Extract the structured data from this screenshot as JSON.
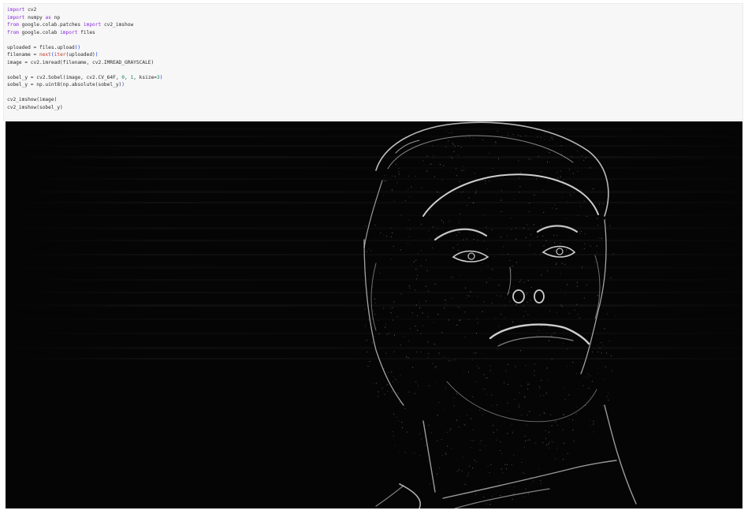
{
  "code_cell": {
    "lines": [
      [
        {
          "t": "import",
          "c": "kw"
        },
        {
          "t": " cv2",
          "c": ""
        }
      ],
      [
        {
          "t": "import",
          "c": "kw"
        },
        {
          "t": " numpy ",
          "c": ""
        },
        {
          "t": "as",
          "c": "kw"
        },
        {
          "t": " np",
          "c": ""
        }
      ],
      [
        {
          "t": "from",
          "c": "kw"
        },
        {
          "t": " google.colab.patches ",
          "c": ""
        },
        {
          "t": "import",
          "c": "kw"
        },
        {
          "t": " cv2_imshow",
          "c": ""
        }
      ],
      [
        {
          "t": "from",
          "c": "kw"
        },
        {
          "t": " google.colab ",
          "c": ""
        },
        {
          "t": "import",
          "c": "kw"
        },
        {
          "t": " files",
          "c": ""
        }
      ],
      [],
      [
        {
          "t": "uploaded = files.upload",
          "c": ""
        },
        {
          "t": "()",
          "c": "paren"
        }
      ],
      [
        {
          "t": "filename = ",
          "c": ""
        },
        {
          "t": "next",
          "c": "fn"
        },
        {
          "t": "(",
          "c": "paren"
        },
        {
          "t": "iter",
          "c": "fn"
        },
        {
          "t": "(uploaded)",
          "c": ""
        },
        {
          "t": ")",
          "c": "paren"
        }
      ],
      [
        {
          "t": "image = cv2.imread(filename, cv2.IMREAD_GRAYSCALE)",
          "c": ""
        }
      ],
      [],
      [
        {
          "t": "sobel_y = cv2.Sobel(image, cv2.CV_64F, ",
          "c": ""
        },
        {
          "t": "0",
          "c": "num"
        },
        {
          "t": ", ",
          "c": ""
        },
        {
          "t": "1",
          "c": "num"
        },
        {
          "t": ", ksize=",
          "c": ""
        },
        {
          "t": "3",
          "c": "num"
        },
        {
          "t": ")",
          "c": "paren"
        }
      ],
      [
        {
          "t": "sobel_y = np.uint8(np.absolute(sobel_y)",
          "c": ""
        },
        {
          "t": ")",
          "c": "paren"
        }
      ],
      [],
      [
        {
          "t": "cv2_imshow(image)",
          "c": ""
        }
      ],
      [
        {
          "t": "cv2_imshow(sobel_y)",
          "c": ""
        }
      ]
    ]
  },
  "output": {
    "description_icon": "sobel-edge-image",
    "background_color": "#050505",
    "edge_color": "#e8e8e8"
  }
}
